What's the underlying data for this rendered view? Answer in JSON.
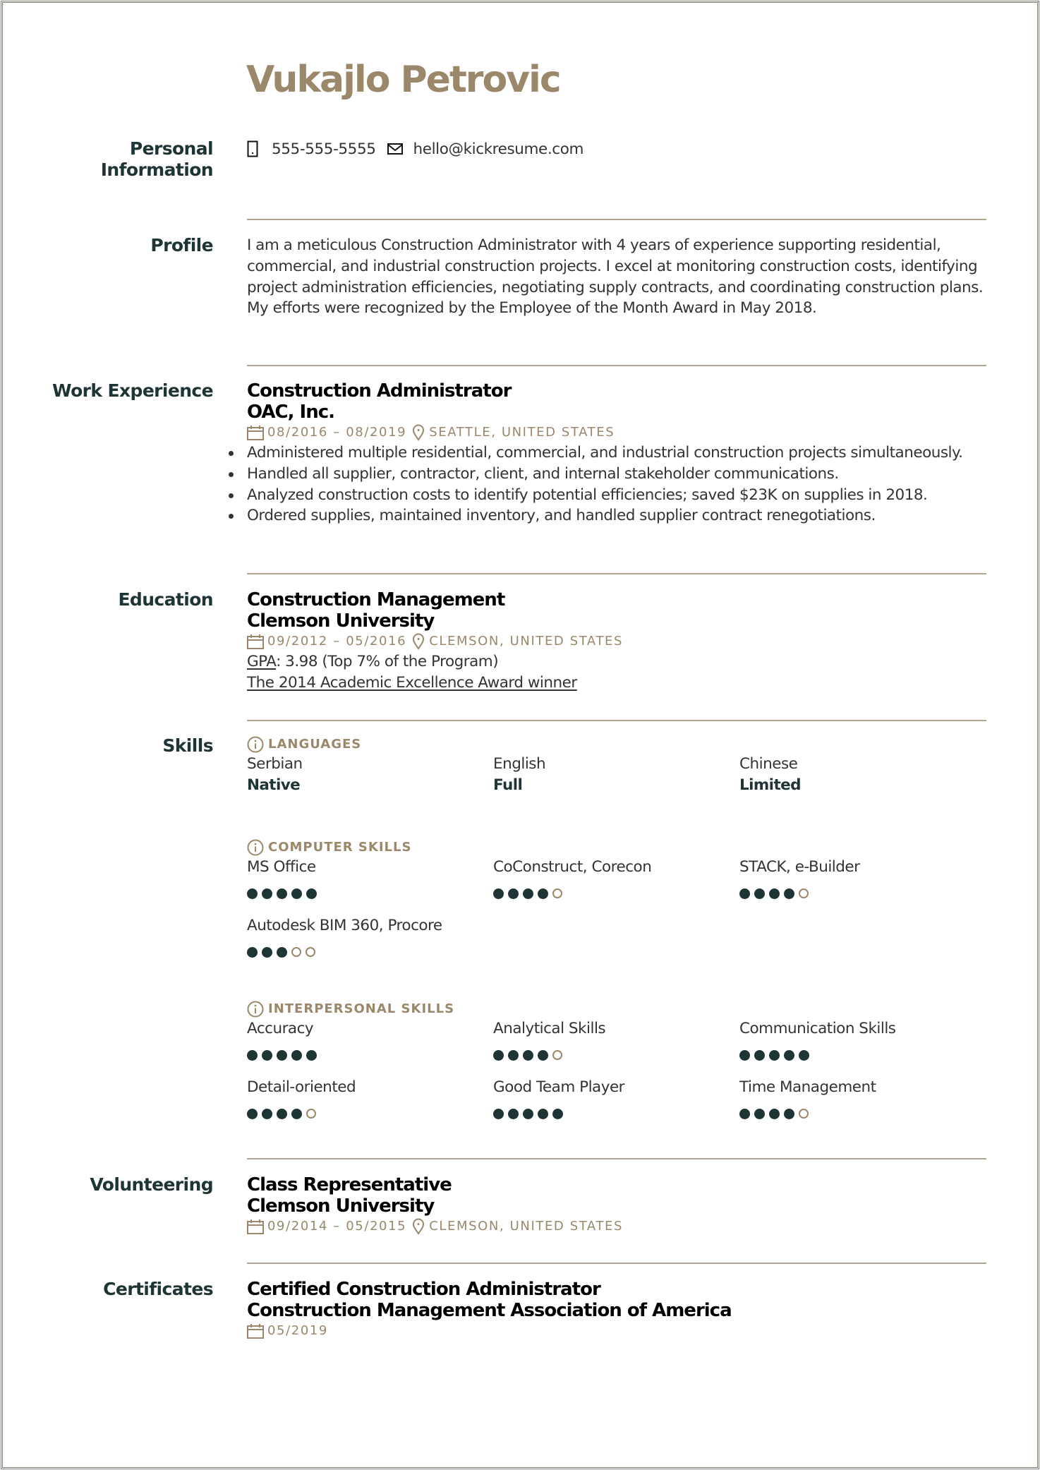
{
  "colors": {
    "accent": "#9b876a",
    "heading": "#1f3535",
    "text": "#333333",
    "rule": "#b0a48f"
  },
  "header": {
    "name": "Vukajlo Petrovic"
  },
  "sections": {
    "personal": {
      "label_line1": "Personal",
      "label_line2": "Information",
      "phone_icon": "phone-icon",
      "phone": "555-555-5555",
      "email_icon": "envelope-icon",
      "email": "hello@kickresume.com"
    },
    "profile": {
      "label": "Profile",
      "text": "I am a meticulous Construction Administrator with 4 years of experience supporting residential, commercial, and industrial construction projects. I excel at monitoring construction costs, identifying project administration efficiencies, negotiating supply contracts, and coordinating construction plans. My efforts were recognized by the Employee of the Month Award in May 2018."
    },
    "work": {
      "label": "Work Experience",
      "entries": [
        {
          "title": "Construction Administrator",
          "org": "OAC, Inc.",
          "dates": "08/2016 – 08/2019",
          "location": "SEATTLE, UNITED STATES",
          "bullets": [
            "Administered multiple residential, commercial, and industrial construction projects simultaneously.",
            "Handled all supplier, contractor, client, and internal stakeholder communications.",
            "Analyzed construction costs to identify potential efficiencies; saved $23K on supplies in 2018.",
            "Ordered supplies, maintained inventory, and handled supplier contract renegotiations."
          ]
        }
      ]
    },
    "education": {
      "label": "Education",
      "entries": [
        {
          "title": "Construction Management",
          "org": "Clemson University",
          "dates": "09/2012 – 05/2016",
          "location": "CLEMSON, UNITED STATES",
          "gpa_label": "GPA",
          "gpa_text": ": 3.98 (Top 7% of the Program)",
          "award": "The 2014 Academic Excellence Award winner"
        }
      ]
    },
    "skills": {
      "label": "Skills",
      "groups": [
        {
          "heading": "LANGUAGES",
          "items": [
            {
              "name": "Serbian",
              "level": "Native"
            },
            {
              "name": "English",
              "level": "Full"
            },
            {
              "name": "Chinese",
              "level": "Limited"
            }
          ]
        },
        {
          "heading": "COMPUTER SKILLS",
          "items": [
            {
              "name": "MS Office",
              "rating": 5,
              "max": 5
            },
            {
              "name": "CoConstruct, Corecon",
              "rating": 4,
              "max": 5
            },
            {
              "name": "STACK, e-Builder",
              "rating": 4,
              "max": 5
            },
            {
              "name": "Autodesk BIM 360, Procore",
              "rating": 3,
              "max": 5
            }
          ]
        },
        {
          "heading": "INTERPERSONAL SKILLS",
          "items": [
            {
              "name": "Accuracy",
              "rating": 5,
              "max": 5
            },
            {
              "name": "Analytical Skills",
              "rating": 4,
              "max": 5
            },
            {
              "name": "Communication Skills",
              "rating": 5,
              "max": 5
            },
            {
              "name": "Detail-oriented",
              "rating": 4,
              "max": 5
            },
            {
              "name": "Good Team Player",
              "rating": 5,
              "max": 5
            },
            {
              "name": "Time Management",
              "rating": 4,
              "max": 5
            }
          ]
        }
      ]
    },
    "volunteering": {
      "label": "Volunteering",
      "entries": [
        {
          "title": "Class Representative",
          "org": "Clemson University",
          "dates": "09/2014 – 05/2015",
          "location": "CLEMSON, UNITED STATES"
        }
      ]
    },
    "certificates": {
      "label": "Certificates",
      "entries": [
        {
          "title": "Certified Construction Administrator",
          "org": "Construction Management Association of America",
          "dates": "05/2019"
        }
      ]
    }
  }
}
